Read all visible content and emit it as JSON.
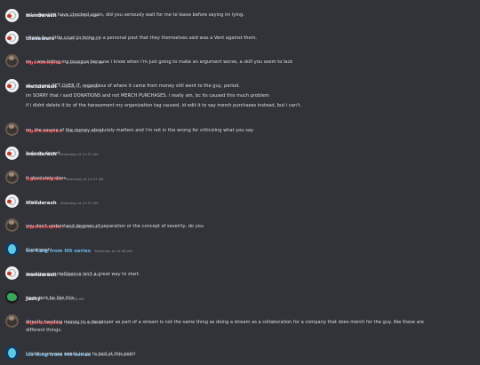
{
  "messages": [
    {
      "user": "menderash",
      "time": "Yesterday at 12:56 AM",
      "lines": [
        "gcl i shouldnt have checked again, did you seriously wait for me to leave before saying im lying."
      ]
    },
    {
      "user": "thesewers",
      "time": "Yesterday at 12:56 AM",
      "lines": [
        "i think its a little cruel to bring yp a personal post that they themselves said was a Vent against them."
      ]
    },
    {
      "user": "tigercomplex",
      "time": "Yesterday at 12:56 AM",
      "lines": [
        "no, i was biting my toungue because i know when i'm just going to make an argument worse, a skill you seem to lack"
      ]
    },
    {
      "user": "menderash",
      "time": "Yesterday at 12:56 AM",
      "lines": [
        "oh my god GET OVER IT. regardless of where it came from money still went to the guy, period.",
        "im SORRY that i said DONATIONS and not MERCH PURCHASES. i really am, bc its caused this much problem",
        "if i didnt delete it bc of the harassment my organization tag caused, id edit it to say merch purchases instead, but i can't."
      ]
    },
    {
      "user": "tigercomplex",
      "time": "Yesterday at 12:57 AM",
      "lines": [
        "no, the source of the money absolutely matters and i'm not in the wrong for criticizing what you say"
      ]
    },
    {
      "user": "menderash",
      "time": "Yesterday at 12:57 AM",
      "lines": [
        "it rly rly doesnt"
      ]
    },
    {
      "user": "tigercomplex",
      "time": "Yesterday at 12:57 AM",
      "lines": [
        "it absolutely does"
      ]
    },
    {
      "user": "menderash",
      "time": "Yesterday at 12:57 AM",
      "lines": [
        "why?"
      ]
    },
    {
      "user": "tigercomplex",
      "time": "Yesterday at 12:58 AM",
      "lines": [
        "you don't understand degrees of separation or the concept of severity, do you"
      ]
    },
    {
      "user": "Ice King from Hit series",
      "time": "Yesterday at 12:58 AM",
      "lines": [
        "Good grief"
      ]
    },
    {
      "user": "menderash",
      "time": "Yesterday at 12:58 AM",
      "lines": [
        "insulting my intelligence isn't a great way to start."
      ]
    },
    {
      "user": "Joshy-",
      "time": "Yesterday at 12:58 AM",
      "lines": [
        "tiger dont be like this"
      ]
    },
    {
      "user": "tigercomplex",
      "time": "Yesterday at 12:58 AM",
      "lines": [
        "directly handing money to a developer as part of a stream is not the same thing as doing a stream as a collaboration for a company that does merch for the guy. like these are",
        "different things."
      ]
    },
    {
      "user": "Ice King from Hit series",
      "time": "Yesterday at 12:58 AM",
      "lines": [
        "I think everyone needs to go to bed at this point"
      ]
    }
  ]
}
